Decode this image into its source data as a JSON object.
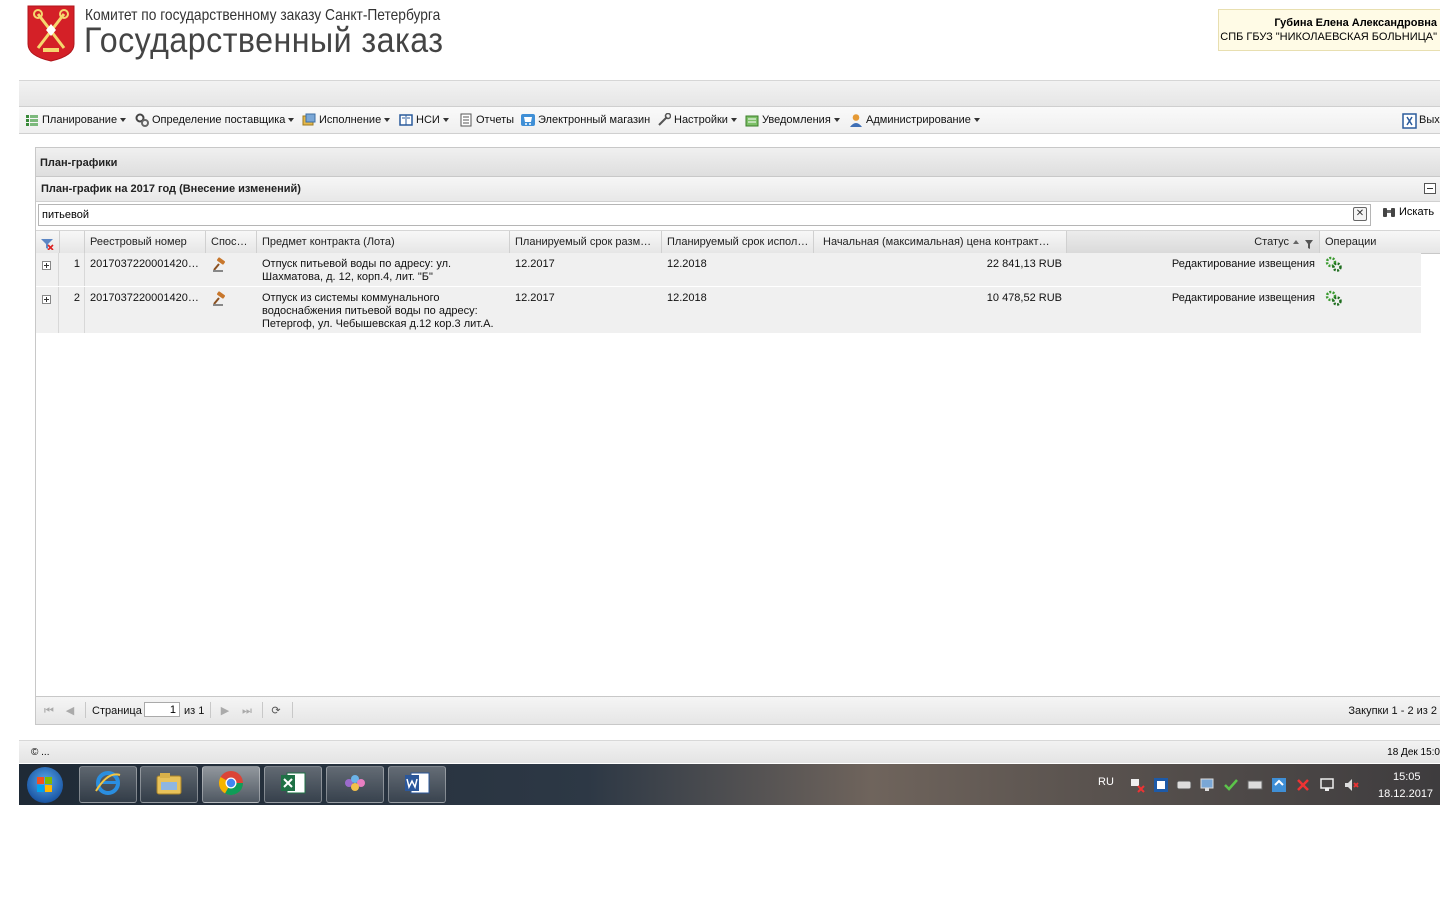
{
  "header": {
    "org_name": "Комитет по государственному заказу Санкт-Петербурга",
    "app_title": "Государственный заказ",
    "user_name": "Губина Елена Александровна",
    "user_org": "СПБ ГБУЗ \"НИКОЛАЕВСКАЯ БОЛЬНИЦА\""
  },
  "menu": {
    "items": [
      {
        "label": "Планирование",
        "icon": "planning-icon",
        "dropdown": true
      },
      {
        "label": "Определение поставщика",
        "icon": "gears-icon",
        "dropdown": true
      },
      {
        "label": "Исполнение",
        "icon": "execution-icon",
        "dropdown": true
      },
      {
        "label": "НСИ",
        "icon": "book-icon",
        "dropdown": true
      },
      {
        "label": "Отчеты",
        "icon": "report-icon",
        "dropdown": false
      },
      {
        "label": "Электронный магазин",
        "icon": "cart-icon",
        "dropdown": false
      },
      {
        "label": "Настройки",
        "icon": "wrench-icon",
        "dropdown": true
      },
      {
        "label": "Уведомления",
        "icon": "notification-icon",
        "dropdown": true
      },
      {
        "label": "Администрирование",
        "icon": "user-icon",
        "dropdown": true
      }
    ],
    "exit_label": "Вых"
  },
  "panel": {
    "title": "План-графики",
    "subtitle": "План-график на 2017 год (Внесение изменений)"
  },
  "search": {
    "value": "питьевой",
    "clear": "✕",
    "button_label": "Искать"
  },
  "grid": {
    "columns": {
      "reg_number": "Реестровый номер",
      "method": "Спос…",
      "subject": "Предмет контракта (Лота)",
      "placement": "Планируемый срок разм…",
      "execution": "Планируемый срок испол…",
      "price": "Начальная (максимальная) цена контракт…",
      "status": "Статус",
      "operations": "Операции"
    },
    "rows": [
      {
        "num": "1",
        "reg_number": "2017037220001420…",
        "subject_line1": "Отпуск питьевой воды по адресу: ул.",
        "subject_line2": "Шахматова, д. 12, корп.4, лит. \"Б\"",
        "subject_line3": "",
        "placement": "12.2017",
        "execution": "12.2018",
        "price": "22 841,13 RUB",
        "status": "Редактирование извещения"
      },
      {
        "num": "2",
        "reg_number": "2017037220001420…",
        "subject_line1": "Отпуск из системы коммунального",
        "subject_line2": "водоснабжения питьевой воды по адресу:",
        "subject_line3": "Петергоф, ул. Чебышевская д.12 кор.3 лит.А.",
        "placement": "12.2017",
        "execution": "12.2018",
        "price": "10 478,52 RUB",
        "status": "Редактирование извещения"
      }
    ]
  },
  "pager": {
    "page_label": "Страница",
    "current_page": "1",
    "of_label": "из 1",
    "summary": "Закупки 1 - 2 из 2"
  },
  "footer": {
    "copyright": "© ...",
    "datetime": "18 Дек 15:0"
  },
  "taskbar": {
    "lang": "RU",
    "time": "15:05",
    "date": "18.12.2017"
  }
}
